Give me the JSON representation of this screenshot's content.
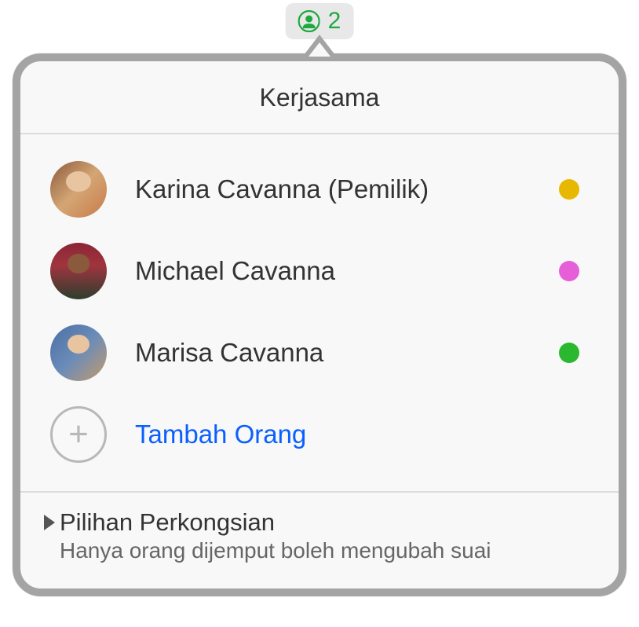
{
  "badge": {
    "count": "2"
  },
  "popover": {
    "title": "Kerjasama",
    "participants": [
      {
        "name": "Karina Cavanna (Pemilik)",
        "status_color": "#e8b800",
        "avatar_class": "avatar-1"
      },
      {
        "name": "Michael Cavanna",
        "status_color": "#e65fd8",
        "avatar_class": "avatar-2"
      },
      {
        "name": "Marisa Cavanna",
        "status_color": "#2ab82e",
        "avatar_class": "avatar-3"
      }
    ],
    "add_label": "Tambah Orang",
    "sharing": {
      "title": "Pilihan Perkongsian",
      "subtitle": "Hanya orang dijemput boleh mengubah suai"
    }
  }
}
